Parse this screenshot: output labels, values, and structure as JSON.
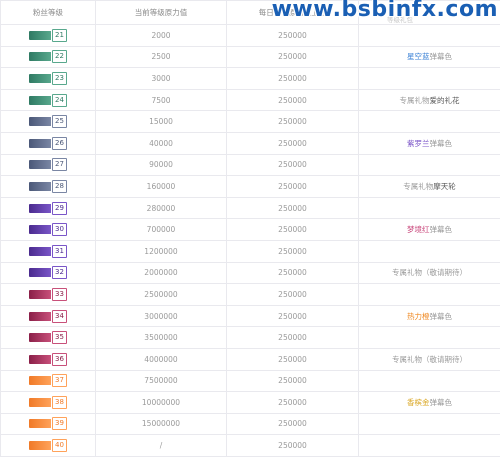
{
  "watermark": "www.bsbinfx.com",
  "headers": {
    "level": "粉丝等级",
    "current": "当前等级原力值",
    "daily": "每日获得原力值上限",
    "reward": "等级礼包"
  },
  "rows": [
    {
      "level": "21",
      "current": "2000",
      "daily": "250000",
      "reward_pre": "",
      "reward_hl": "",
      "reward_post": "",
      "color": "#2f7a63",
      "color2": "#58a88d",
      "hl_color": ""
    },
    {
      "level": "22",
      "current": "2500",
      "daily": "250000",
      "reward_pre": "",
      "reward_hl": "星空蓝",
      "reward_post": "弹幕色",
      "color": "#2f7a63",
      "color2": "#58a88d",
      "hl_color": "#3b82d6"
    },
    {
      "level": "23",
      "current": "3000",
      "daily": "250000",
      "reward_pre": "",
      "reward_hl": "",
      "reward_post": "",
      "color": "#2f7a63",
      "color2": "#58a88d",
      "hl_color": ""
    },
    {
      "level": "24",
      "current": "7500",
      "daily": "250000",
      "reward_pre": "专属礼物",
      "reward_hl": "爱的礼花",
      "reward_post": "",
      "color": "#2f7a63",
      "color2": "#58a88d",
      "hl_color": "#555555"
    },
    {
      "level": "25",
      "current": "15000",
      "daily": "250000",
      "reward_pre": "",
      "reward_hl": "",
      "reward_post": "",
      "color": "#4b5878",
      "color2": "#7a86a4",
      "hl_color": ""
    },
    {
      "level": "26",
      "current": "40000",
      "daily": "250000",
      "reward_pre": "",
      "reward_hl": "紫罗兰",
      "reward_post": "弹幕色",
      "color": "#4b5878",
      "color2": "#7a86a4",
      "hl_color": "#7b55c8"
    },
    {
      "level": "27",
      "current": "90000",
      "daily": "250000",
      "reward_pre": "",
      "reward_hl": "",
      "reward_post": "",
      "color": "#4b5878",
      "color2": "#7a86a4",
      "hl_color": ""
    },
    {
      "level": "28",
      "current": "160000",
      "daily": "250000",
      "reward_pre": "专属礼物",
      "reward_hl": "摩天轮",
      "reward_post": "",
      "color": "#4b5878",
      "color2": "#7a86a4",
      "hl_color": "#555555"
    },
    {
      "level": "29",
      "current": "280000",
      "daily": "250000",
      "reward_pre": "",
      "reward_hl": "",
      "reward_post": "",
      "color": "#4a2a8e",
      "color2": "#7a56c8",
      "hl_color": ""
    },
    {
      "level": "30",
      "current": "700000",
      "daily": "250000",
      "reward_pre": "",
      "reward_hl": "梦境红",
      "reward_post": "弹幕色",
      "color": "#4a2a8e",
      "color2": "#7a56c8",
      "hl_color": "#c8457a"
    },
    {
      "level": "31",
      "current": "1200000",
      "daily": "250000",
      "reward_pre": "",
      "reward_hl": "",
      "reward_post": "",
      "color": "#4a2a8e",
      "color2": "#7a56c8",
      "hl_color": ""
    },
    {
      "level": "32",
      "current": "2000000",
      "daily": "250000",
      "reward_pre": "专属礼物（敬请期待）",
      "reward_hl": "",
      "reward_post": "",
      "color": "#4a2a8e",
      "color2": "#7a56c8",
      "hl_color": ""
    },
    {
      "level": "33",
      "current": "2500000",
      "daily": "250000",
      "reward_pre": "",
      "reward_hl": "",
      "reward_post": "",
      "color": "#8a1f48",
      "color2": "#c8507a",
      "hl_color": ""
    },
    {
      "level": "34",
      "current": "3000000",
      "daily": "250000",
      "reward_pre": "",
      "reward_hl": "热力橙",
      "reward_post": "弹幕色",
      "color": "#8a1f48",
      "color2": "#c8507a",
      "hl_color": "#f08a24"
    },
    {
      "level": "35",
      "current": "3500000",
      "daily": "250000",
      "reward_pre": "",
      "reward_hl": "",
      "reward_post": "",
      "color": "#8a1f48",
      "color2": "#c8507a",
      "hl_color": ""
    },
    {
      "level": "36",
      "current": "4000000",
      "daily": "250000",
      "reward_pre": "专属礼物（敬请期待）",
      "reward_hl": "",
      "reward_post": "",
      "color": "#8a1f48",
      "color2": "#c8507a",
      "hl_color": ""
    },
    {
      "level": "37",
      "current": "7500000",
      "daily": "250000",
      "reward_pre": "",
      "reward_hl": "",
      "reward_post": "",
      "color": "#f07a28",
      "color2": "#ffa25a",
      "hl_color": ""
    },
    {
      "level": "38",
      "current": "10000000",
      "daily": "250000",
      "reward_pre": "",
      "reward_hl": "香槟金",
      "reward_post": "弹幕色",
      "color": "#f07a28",
      "color2": "#ffa25a",
      "hl_color": "#d9a520"
    },
    {
      "level": "39",
      "current": "15000000",
      "daily": "250000",
      "reward_pre": "",
      "reward_hl": "",
      "reward_post": "",
      "color": "#f07a28",
      "color2": "#ffa25a",
      "hl_color": ""
    },
    {
      "level": "40",
      "current": "/",
      "daily": "250000",
      "reward_pre": "",
      "reward_hl": "",
      "reward_post": "",
      "color": "#f07a28",
      "color2": "#ffa25a",
      "hl_color": ""
    }
  ]
}
